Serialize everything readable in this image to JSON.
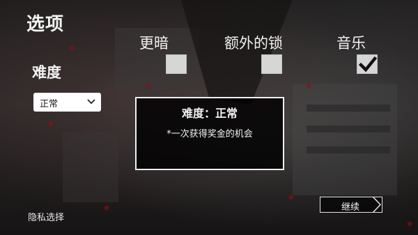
{
  "title": "选项",
  "options": {
    "darker": {
      "label": "更暗",
      "checked": false
    },
    "extra_locks": {
      "label": "额外的锁",
      "checked": false
    },
    "music": {
      "label": "音乐",
      "checked": true
    }
  },
  "difficulty": {
    "label": "难度",
    "selected": "正常"
  },
  "info": {
    "title": "难度：正常",
    "description": "*一次获得奖金的机会"
  },
  "privacy_label": "隐私选择",
  "continue_label": "继续",
  "colors": {
    "checkbox": "#d6d6d6",
    "text": "#f2f2f2",
    "accent_blood": "#8a1010"
  },
  "icons": {
    "check": "check-icon",
    "dropdown": "chevron-down-icon",
    "continue_arrow": "chevron-right-icon"
  }
}
